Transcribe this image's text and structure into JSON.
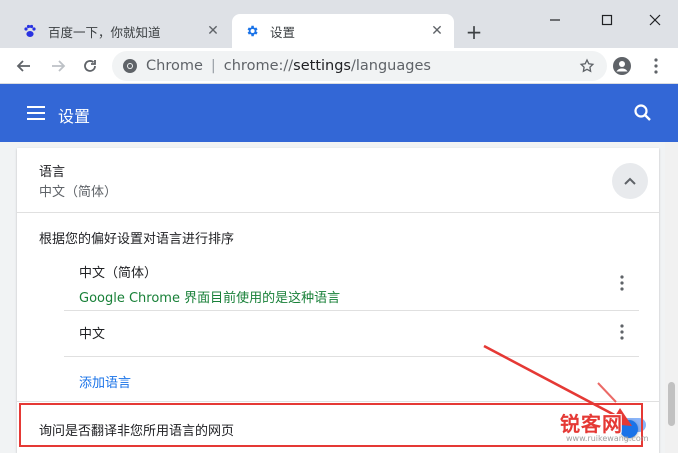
{
  "tabs": [
    {
      "title": "百度一下，你就知道",
      "favicon": "baidu-paw-icon",
      "active": false
    },
    {
      "title": "设置",
      "favicon": "settings-gear-icon",
      "active": true
    }
  ],
  "toolbar": {
    "site_label": "Chrome",
    "url_scheme": "chrome://",
    "url_host": "settings",
    "url_path": "/languages"
  },
  "header": {
    "title": "设置"
  },
  "language_section": {
    "label": "语言",
    "current": "中文（简体）",
    "order_label": "根据您的偏好设置对语言进行排序",
    "languages": [
      {
        "name": "中文（简体）",
        "note": "Google Chrome 界面目前使用的是这种语言"
      },
      {
        "name": "中文",
        "note": ""
      }
    ],
    "add_language": "添加语言",
    "translate_offer": "询问是否翻译非您所用语言的网页",
    "translate_enabled": true
  },
  "watermark": {
    "brand": "锐客网",
    "url": "www.ruikewang.com"
  },
  "colors": {
    "header_blue": "#3367d6",
    "link_blue": "#1a73e8",
    "note_green": "#188038",
    "annotation_red": "#e53935"
  }
}
